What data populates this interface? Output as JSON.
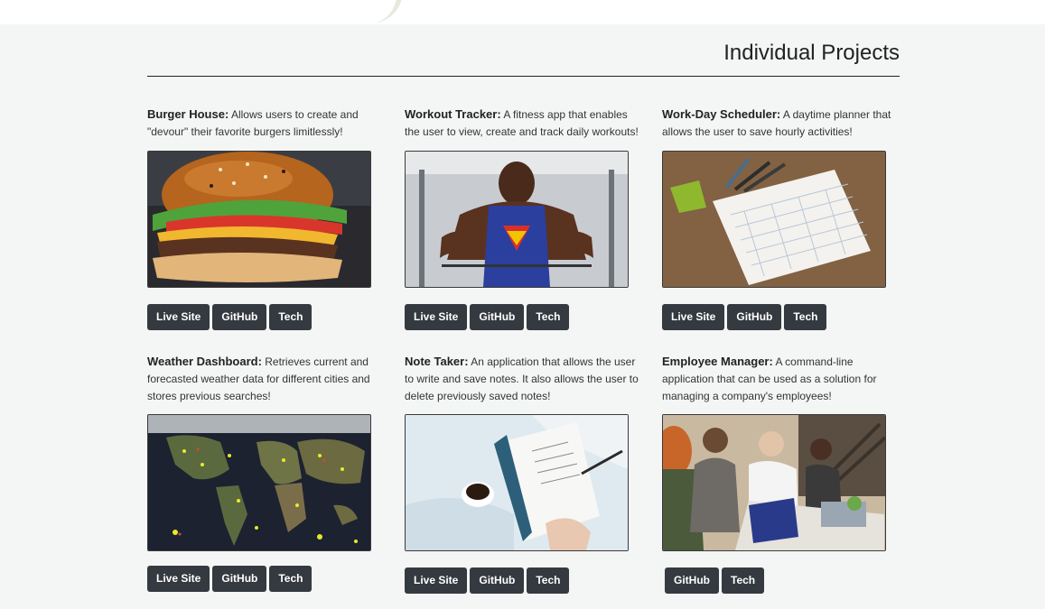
{
  "section": {
    "title": "Individual Projects"
  },
  "projects": [
    {
      "name": "Burger House:",
      "description": "Allows users to create and \"devour\" their favorite burgers limitlessly!",
      "image": "burger-photo",
      "buttons": [
        "Live Site",
        "GitHub",
        "Tech"
      ]
    },
    {
      "name": "Workout Tracker:",
      "description": "A fitness app that enables the user to view, create and track daily workouts!",
      "image": "bodybuilder-photo",
      "buttons": [
        "Live Site",
        "GitHub",
        "Tech"
      ]
    },
    {
      "name": "Work-Day Scheduler:",
      "description": "A daytime planner that allows the user to save hourly activities!",
      "image": "planner-notebook-photo",
      "buttons": [
        "Live Site",
        "GitHub",
        "Tech"
      ]
    },
    {
      "name": "Weather Dashboard:",
      "description": "Retrieves current and forecasted weather data for different cities and stores previous searches!",
      "image": "world-weather-map-photo",
      "buttons": [
        "Live Site",
        "GitHub",
        "Tech"
      ]
    },
    {
      "name": "Note Taker:",
      "description": "An application that allows the user to write and save notes. It also allows the user to delete previously saved notes!",
      "image": "notebook-coffee-photo",
      "buttons": [
        "Live Site",
        "GitHub",
        "Tech"
      ]
    },
    {
      "name": "Employee Manager:",
      "description": "A command-line application that can be used as a solution for managing a company's employees!",
      "image": "office-meeting-photo",
      "buttons": [
        "GitHub",
        "Tech"
      ]
    }
  ],
  "colors": {
    "background": "#f4f5f5",
    "button": "#343a40",
    "button_text": "#ffffff",
    "rule": "#222222"
  }
}
